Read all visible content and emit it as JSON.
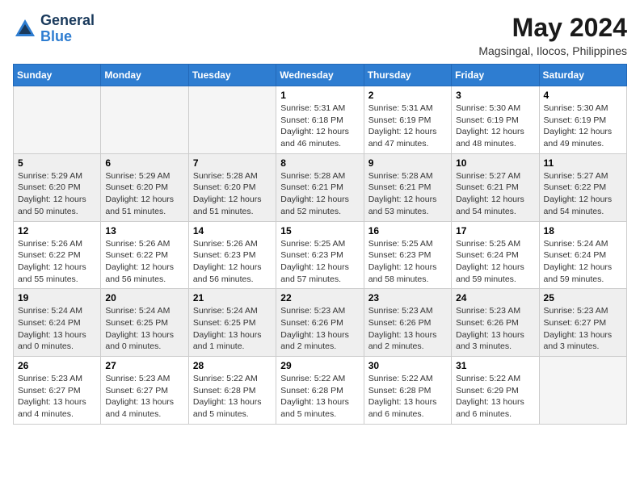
{
  "logo": {
    "line1": "General",
    "line2": "Blue"
  },
  "title": "May 2024",
  "location": "Magsingal, Ilocos, Philippines",
  "weekdays": [
    "Sunday",
    "Monday",
    "Tuesday",
    "Wednesday",
    "Thursday",
    "Friday",
    "Saturday"
  ],
  "weeks": [
    [
      {
        "day": "",
        "info": ""
      },
      {
        "day": "",
        "info": ""
      },
      {
        "day": "",
        "info": ""
      },
      {
        "day": "1",
        "info": "Sunrise: 5:31 AM\nSunset: 6:18 PM\nDaylight: 12 hours\nand 46 minutes."
      },
      {
        "day": "2",
        "info": "Sunrise: 5:31 AM\nSunset: 6:19 PM\nDaylight: 12 hours\nand 47 minutes."
      },
      {
        "day": "3",
        "info": "Sunrise: 5:30 AM\nSunset: 6:19 PM\nDaylight: 12 hours\nand 48 minutes."
      },
      {
        "day": "4",
        "info": "Sunrise: 5:30 AM\nSunset: 6:19 PM\nDaylight: 12 hours\nand 49 minutes."
      }
    ],
    [
      {
        "day": "5",
        "info": "Sunrise: 5:29 AM\nSunset: 6:20 PM\nDaylight: 12 hours\nand 50 minutes."
      },
      {
        "day": "6",
        "info": "Sunrise: 5:29 AM\nSunset: 6:20 PM\nDaylight: 12 hours\nand 51 minutes."
      },
      {
        "day": "7",
        "info": "Sunrise: 5:28 AM\nSunset: 6:20 PM\nDaylight: 12 hours\nand 51 minutes."
      },
      {
        "day": "8",
        "info": "Sunrise: 5:28 AM\nSunset: 6:21 PM\nDaylight: 12 hours\nand 52 minutes."
      },
      {
        "day": "9",
        "info": "Sunrise: 5:28 AM\nSunset: 6:21 PM\nDaylight: 12 hours\nand 53 minutes."
      },
      {
        "day": "10",
        "info": "Sunrise: 5:27 AM\nSunset: 6:21 PM\nDaylight: 12 hours\nand 54 minutes."
      },
      {
        "day": "11",
        "info": "Sunrise: 5:27 AM\nSunset: 6:22 PM\nDaylight: 12 hours\nand 54 minutes."
      }
    ],
    [
      {
        "day": "12",
        "info": "Sunrise: 5:26 AM\nSunset: 6:22 PM\nDaylight: 12 hours\nand 55 minutes."
      },
      {
        "day": "13",
        "info": "Sunrise: 5:26 AM\nSunset: 6:22 PM\nDaylight: 12 hours\nand 56 minutes."
      },
      {
        "day": "14",
        "info": "Sunrise: 5:26 AM\nSunset: 6:23 PM\nDaylight: 12 hours\nand 56 minutes."
      },
      {
        "day": "15",
        "info": "Sunrise: 5:25 AM\nSunset: 6:23 PM\nDaylight: 12 hours\nand 57 minutes."
      },
      {
        "day": "16",
        "info": "Sunrise: 5:25 AM\nSunset: 6:23 PM\nDaylight: 12 hours\nand 58 minutes."
      },
      {
        "day": "17",
        "info": "Sunrise: 5:25 AM\nSunset: 6:24 PM\nDaylight: 12 hours\nand 59 minutes."
      },
      {
        "day": "18",
        "info": "Sunrise: 5:24 AM\nSunset: 6:24 PM\nDaylight: 12 hours\nand 59 minutes."
      }
    ],
    [
      {
        "day": "19",
        "info": "Sunrise: 5:24 AM\nSunset: 6:24 PM\nDaylight: 13 hours\nand 0 minutes."
      },
      {
        "day": "20",
        "info": "Sunrise: 5:24 AM\nSunset: 6:25 PM\nDaylight: 13 hours\nand 0 minutes."
      },
      {
        "day": "21",
        "info": "Sunrise: 5:24 AM\nSunset: 6:25 PM\nDaylight: 13 hours\nand 1 minute."
      },
      {
        "day": "22",
        "info": "Sunrise: 5:23 AM\nSunset: 6:26 PM\nDaylight: 13 hours\nand 2 minutes."
      },
      {
        "day": "23",
        "info": "Sunrise: 5:23 AM\nSunset: 6:26 PM\nDaylight: 13 hours\nand 2 minutes."
      },
      {
        "day": "24",
        "info": "Sunrise: 5:23 AM\nSunset: 6:26 PM\nDaylight: 13 hours\nand 3 minutes."
      },
      {
        "day": "25",
        "info": "Sunrise: 5:23 AM\nSunset: 6:27 PM\nDaylight: 13 hours\nand 3 minutes."
      }
    ],
    [
      {
        "day": "26",
        "info": "Sunrise: 5:23 AM\nSunset: 6:27 PM\nDaylight: 13 hours\nand 4 minutes."
      },
      {
        "day": "27",
        "info": "Sunrise: 5:23 AM\nSunset: 6:27 PM\nDaylight: 13 hours\nand 4 minutes."
      },
      {
        "day": "28",
        "info": "Sunrise: 5:22 AM\nSunset: 6:28 PM\nDaylight: 13 hours\nand 5 minutes."
      },
      {
        "day": "29",
        "info": "Sunrise: 5:22 AM\nSunset: 6:28 PM\nDaylight: 13 hours\nand 5 minutes."
      },
      {
        "day": "30",
        "info": "Sunrise: 5:22 AM\nSunset: 6:28 PM\nDaylight: 13 hours\nand 6 minutes."
      },
      {
        "day": "31",
        "info": "Sunrise: 5:22 AM\nSunset: 6:29 PM\nDaylight: 13 hours\nand 6 minutes."
      },
      {
        "day": "",
        "info": ""
      }
    ]
  ]
}
